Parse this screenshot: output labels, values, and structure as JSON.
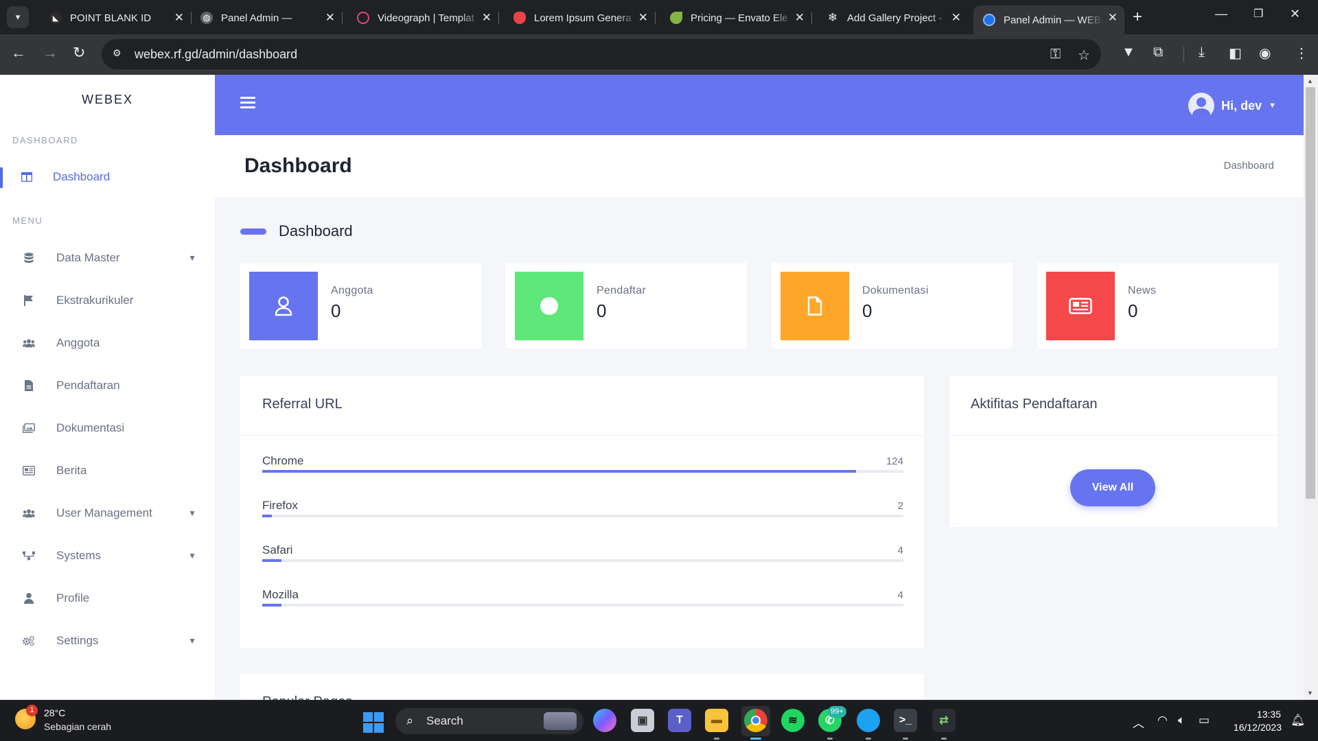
{
  "browser": {
    "tabs": [
      {
        "label": "POINT BLANK ID",
        "icon": "pointblank-icon"
      },
      {
        "label": "Panel Admin —",
        "icon": "globe-icon"
      },
      {
        "label": "Videograph | Templat",
        "icon": "videograph-icon"
      },
      {
        "label": "Lorem Ipsum Genera",
        "icon": "lorem-icon"
      },
      {
        "label": "Pricing — Envato Ele",
        "icon": "envato-leaf-icon"
      },
      {
        "label": "Add Gallery Project -",
        "icon": "gallery-snowflake-icon"
      },
      {
        "label": "Panel Admin — WEB",
        "icon": "webex-icon",
        "active": true
      }
    ],
    "url": "webex.rf.gd/admin/dashboard"
  },
  "sidebar": {
    "brand": "WEBEX",
    "heading_dashboard": "DASHBOARD",
    "dashboard_item": "Dashboard",
    "heading_menu": "MENU",
    "items": [
      {
        "label": "Data Master",
        "icon": "database-icon",
        "dropdown": true
      },
      {
        "label": "Ekstrakurikuler",
        "icon": "flag-icon",
        "dropdown": false
      },
      {
        "label": "Anggota",
        "icon": "users-icon",
        "dropdown": false
      },
      {
        "label": "Pendaftaran",
        "icon": "file-icon",
        "dropdown": false
      },
      {
        "label": "Dokumentasi",
        "icon": "images-icon",
        "dropdown": false
      },
      {
        "label": "Berita",
        "icon": "newspaper-icon",
        "dropdown": false
      },
      {
        "label": "User Management",
        "icon": "users-cog-icon",
        "dropdown": true
      },
      {
        "label": "Systems",
        "icon": "network-icon",
        "dropdown": true
      },
      {
        "label": "Profile",
        "icon": "user-icon",
        "dropdown": false
      },
      {
        "label": "Settings",
        "icon": "cogs-icon",
        "dropdown": true
      }
    ]
  },
  "topbar": {
    "greeting": "Hi, dev"
  },
  "page": {
    "title": "Dashboard",
    "breadcrumb": "Dashboard",
    "section_title": "Dashboard"
  },
  "stats": [
    {
      "label": "Anggota",
      "value": "0",
      "color": "#6674ef",
      "icon": "user-icon"
    },
    {
      "label": "Pendaftar",
      "value": "0",
      "color": "#5ee87a",
      "icon": "circle-icon"
    },
    {
      "label": "Dokumentasi",
      "value": "0",
      "color": "#ffa72b",
      "icon": "file-icon"
    },
    {
      "label": "News",
      "value": "0",
      "color": "#f5484b",
      "icon": "newspaper-icon"
    }
  ],
  "referral": {
    "title": "Referral URL",
    "rows": [
      {
        "name": "Chrome",
        "value": "124",
        "fill": 0.926
      },
      {
        "name": "Firefox",
        "value": "2",
        "fill": 0.015
      },
      {
        "name": "Safari",
        "value": "4",
        "fill": 0.03
      },
      {
        "name": "Mozilla",
        "value": "4",
        "fill": 0.03
      }
    ]
  },
  "activity": {
    "title": "Aktifitas Pendaftaran",
    "button": "View All"
  },
  "next_card_title": "Popular Pages",
  "taskbar": {
    "temperature": "28°C",
    "weather": "Sebagian cerah",
    "weather_badge": "1",
    "search": "Search",
    "whatsapp_badge": "99+",
    "time": "13:35",
    "date": "16/12/2023"
  },
  "colors": {
    "accent": "#6674ef",
    "sidebar_active": "#5469e9"
  }
}
